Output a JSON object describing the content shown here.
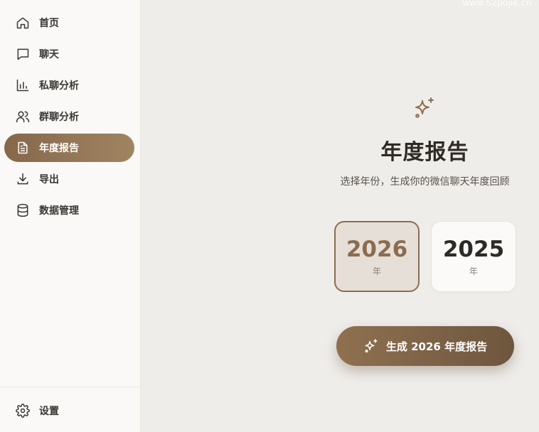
{
  "watermark": "www.52pojie.cn",
  "sidebar": {
    "items": [
      {
        "label": "首页",
        "icon": "home-icon",
        "active": false
      },
      {
        "label": "聊天",
        "icon": "chat-bubble-icon",
        "active": false
      },
      {
        "label": "私聊分析",
        "icon": "bar-chart-icon",
        "active": false
      },
      {
        "label": "群聊分析",
        "icon": "users-icon",
        "active": false
      },
      {
        "label": "年度报告",
        "icon": "document-icon",
        "active": true
      },
      {
        "label": "导出",
        "icon": "download-icon",
        "active": false
      },
      {
        "label": "数据管理",
        "icon": "database-icon",
        "active": false
      }
    ],
    "settings_label": "设置",
    "settings_icon": "gear-icon"
  },
  "main": {
    "icon": "sparkles-icon",
    "title": "年度报告",
    "subtitle": "选择年份，生成你的微信聊天年度回顾",
    "years": [
      {
        "year": "2026",
        "unit": "年",
        "selected": true
      },
      {
        "year": "2025",
        "unit": "年",
        "selected": false
      }
    ],
    "generate_button": {
      "label": "生成 2026 年度报告",
      "icon": "sparkles-icon"
    }
  },
  "colors": {
    "accent": "#8b6c4e",
    "background": "#efedea",
    "sidebar_bg": "#faf9f7"
  }
}
